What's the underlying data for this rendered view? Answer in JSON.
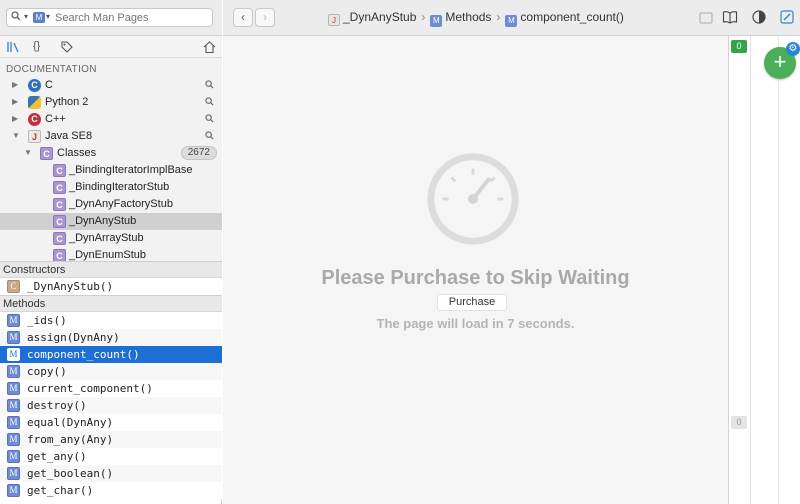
{
  "search": {
    "placeholder": "Search Man Pages",
    "scope_badge": "M"
  },
  "tabs": {
    "library": "IIIA",
    "braces": "{}",
    "tag": "⌂"
  },
  "sidebar": {
    "section_title": "DOCUMENTATION",
    "docsets": [
      {
        "label": "C",
        "icon": "C"
      },
      {
        "label": "Python 2",
        "icon": ""
      },
      {
        "label": "C++",
        "icon": "C"
      },
      {
        "label": "Java SE8",
        "icon": "J"
      }
    ],
    "classes": {
      "label": "Classes",
      "count": "2672",
      "icon": "C"
    },
    "class_items": [
      "_BindingIteratorImplBase",
      "_BindingIteratorStub",
      "_DynAnyFactoryStub",
      "_DynAnyStub",
      "_DynArrayStub",
      "_DynEnumStub"
    ],
    "class_icon": "C"
  },
  "members": {
    "constructors_header": "Constructors",
    "constructors": [
      {
        "icon": "C",
        "label": "_DynAnyStub()"
      }
    ],
    "methods_header": "Methods",
    "method_icon": "M",
    "methods": [
      "_ids()",
      "assign(DynAny)",
      "component_count()",
      "copy()",
      "current_component()",
      "destroy()",
      "equal(DynAny)",
      "from_any(Any)",
      "get_any()",
      "get_boolean()",
      "get_char()"
    ]
  },
  "toolbar": {
    "back": "‹",
    "forward": "›",
    "breadcrumb": [
      {
        "icon": "J",
        "label": "_DynAnyStub"
      },
      {
        "icon": "M",
        "label": "Methods"
      },
      {
        "icon": "M",
        "label": "component_count()"
      }
    ],
    "separator": "›"
  },
  "overlay": {
    "title": "Please Purchase to Skip Waiting",
    "button": "Purchase",
    "subtitle": "The page will load in 7 seconds."
  },
  "right_strip": {
    "top_count": "0",
    "bottom_count": "0",
    "add_label": "+",
    "gear_label": "⚙"
  },
  "colors": {
    "selection": "#1d6fd6",
    "accent_green": "#4cae58",
    "method_icon": "#6e8bd5"
  }
}
